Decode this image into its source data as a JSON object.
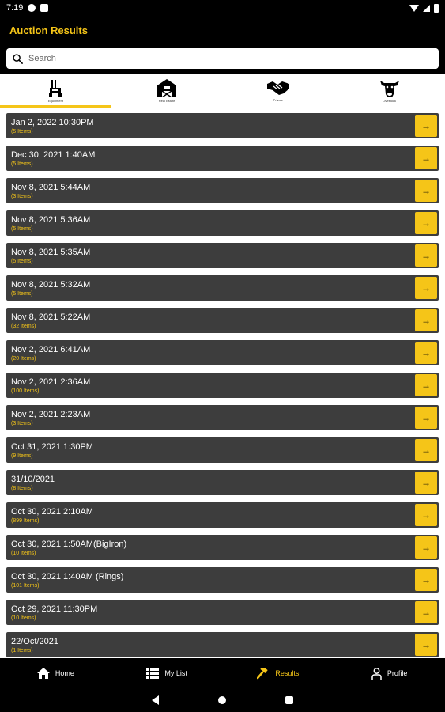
{
  "status": {
    "time": "7:19"
  },
  "header": {
    "title": "Auction Results"
  },
  "search": {
    "placeholder": "Search"
  },
  "tabs": [
    {
      "label": "Equipment",
      "icon": "tractor-icon",
      "active": true
    },
    {
      "label": "Real Estate",
      "icon": "barn-icon",
      "active": false
    },
    {
      "label": "Private",
      "icon": "handshake-icon",
      "active": false
    },
    {
      "label": "Livestock",
      "icon": "cow-icon",
      "active": false
    }
  ],
  "results": [
    {
      "date": "Jan 2, 2022 10:30PM",
      "count": "(5 Items)"
    },
    {
      "date": "Dec 30, 2021 1:40AM",
      "count": "(5 Items)"
    },
    {
      "date": "Nov 8, 2021 5:44AM",
      "count": "(3 Items)"
    },
    {
      "date": "Nov 8, 2021 5:36AM",
      "count": "(5 Items)"
    },
    {
      "date": "Nov 8, 2021 5:35AM",
      "count": "(5 Items)"
    },
    {
      "date": "Nov 8, 2021 5:32AM",
      "count": "(5 Items)"
    },
    {
      "date": "Nov 8, 2021 5:22AM",
      "count": "(32 Items)"
    },
    {
      "date": "Nov 2, 2021 6:41AM",
      "count": "(20 Items)"
    },
    {
      "date": "Nov 2, 2021 2:36AM",
      "count": "(100 Items)"
    },
    {
      "date": "Nov 2, 2021 2:23AM",
      "count": "(3 Items)"
    },
    {
      "date": "Oct 31, 2021 1:30PM",
      "count": "(9 Items)"
    },
    {
      "date": "31/10/2021",
      "count": "(8 Items)"
    },
    {
      "date": "Oct 30, 2021 2:10AM",
      "count": "(899 Items)"
    },
    {
      "date": "Oct 30, 2021 1:50AM(BigIron)",
      "count": "(10 Items)"
    },
    {
      "date": "Oct 30, 2021 1:40AM (Rings)",
      "count": "(101 Items)"
    },
    {
      "date": "Oct 29, 2021 11:30PM",
      "count": "(10 Items)"
    },
    {
      "date": "22/Oct/2021",
      "count": "(1 Items)"
    }
  ],
  "bottom_nav": [
    {
      "label": "Home",
      "icon": "home-icon",
      "active": false
    },
    {
      "label": "My List",
      "icon": "list-icon",
      "active": false
    },
    {
      "label": "Results",
      "icon": "gavel-icon",
      "active": true
    },
    {
      "label": "Profile",
      "icon": "person-icon",
      "active": false
    }
  ],
  "colors": {
    "accent": "#f5c518",
    "row_bg": "#3d3d3d",
    "header_bg": "#000000"
  }
}
